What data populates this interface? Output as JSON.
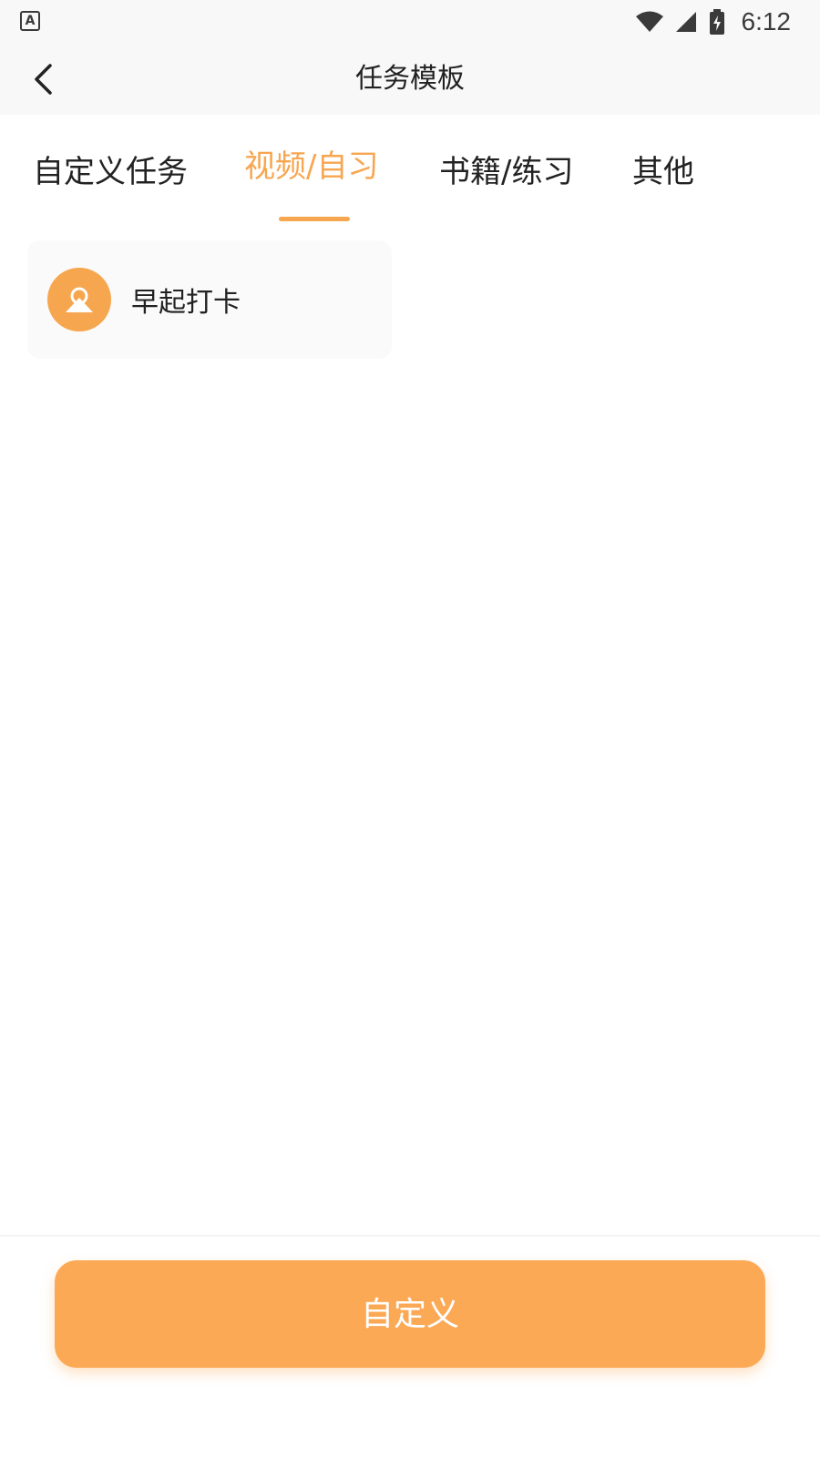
{
  "status_bar": {
    "app_icon_letter": "A",
    "time": "6:12"
  },
  "nav": {
    "title": "任务模板"
  },
  "tabs": [
    {
      "label": "自定义任务",
      "active": false
    },
    {
      "label": "视频/自习",
      "active": true
    },
    {
      "label": "书籍/练习",
      "active": false
    },
    {
      "label": "其他",
      "active": false
    }
  ],
  "templates": [
    {
      "label": "早起打卡",
      "icon": "sunrise-icon"
    }
  ],
  "footer": {
    "custom_button_label": "自定义"
  },
  "colors": {
    "accent": "#f7a650",
    "button": "#fca956",
    "text": "#222222"
  }
}
